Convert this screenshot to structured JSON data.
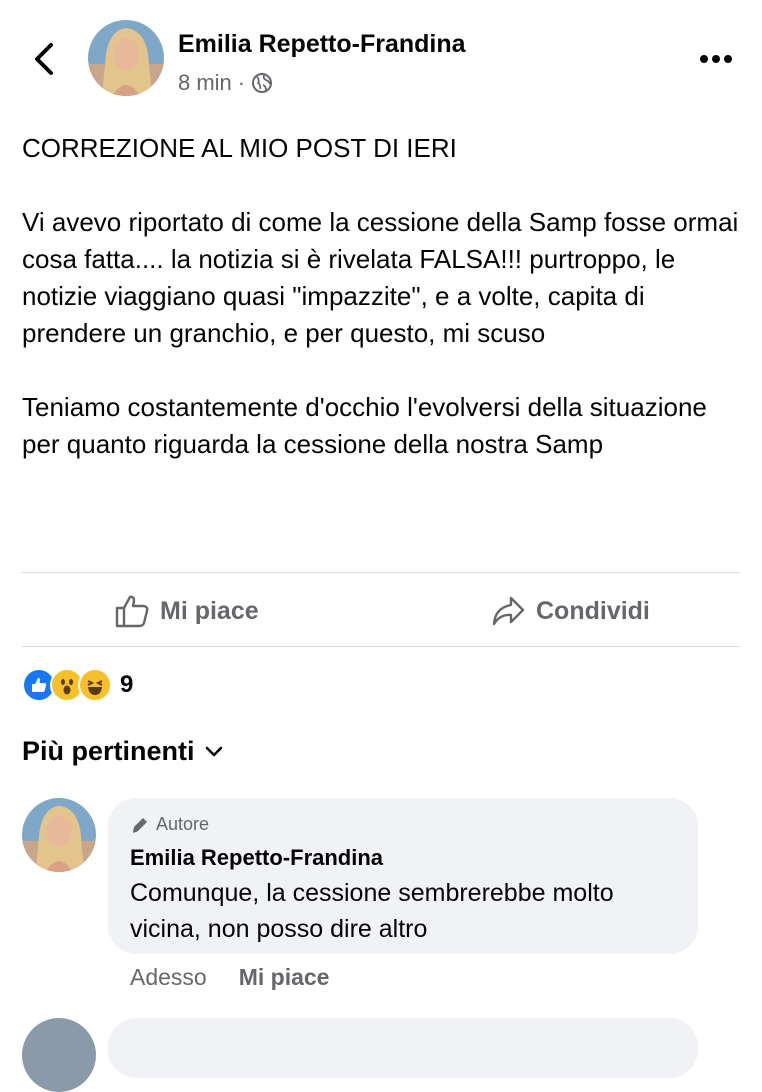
{
  "post": {
    "author": "Emilia Repetto-Frandina",
    "time": "8 min",
    "separator": "·",
    "privacy_icon": "globe-icon",
    "paragraphs": [
      "CORREZIONE AL MIO POST DI IERI",
      "Vi avevo riportato di come la cessione della Samp fosse ormai cosa fatta.... la notizia si è rivelata FALSA!!! purtroppo, le notizie viaggiano quasi \"impazzite\", e a volte, capita di prendere un granchio, e per questo, mi scuso",
      "Teniamo costantemente d'occhio l'evolversi della situazione per quanto riguarda la cessione della nostra Samp"
    ]
  },
  "actions": {
    "like_label": "Mi piace",
    "share_label": "Condividi"
  },
  "reactions": {
    "icons": [
      "like-reaction-icon",
      "wow-reaction-icon",
      "haha-reaction-icon"
    ],
    "count": "9"
  },
  "comments_sort": {
    "label": "Più pertinenti"
  },
  "comment": {
    "badge": "Autore",
    "author": "Emilia Repetto-Frandina",
    "text": "Comunque, la cessione sembrerebbe molto vicina, non posso dire altro",
    "time": "Adesso",
    "like_label": "Mi piace"
  },
  "colors": {
    "secondary_text": "#65676b",
    "bubble_bg": "#f0f2f5",
    "like_blue": "#1877f2"
  }
}
